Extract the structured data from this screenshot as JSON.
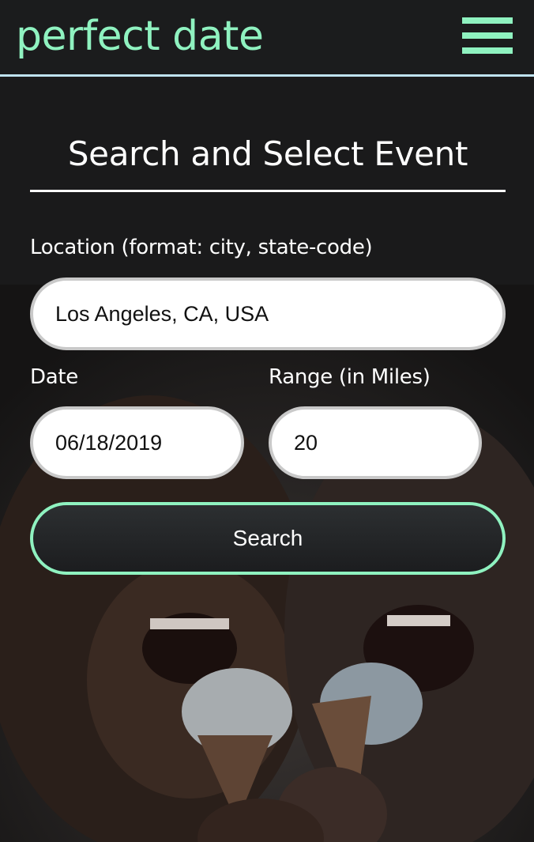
{
  "header": {
    "brand": "perfect date",
    "menu_icon": "hamburger-menu-icon"
  },
  "form": {
    "title": "Search and Select Event",
    "location_label": "Location (format: city, state-code)",
    "location_value": "Los Angeles, CA, USA",
    "date_label": "Date",
    "date_value": "06/18/2019",
    "range_label": "Range (in Miles)",
    "range_value": "20",
    "search_label": "Search"
  },
  "colors": {
    "accent": "#8ff2c0",
    "header_border": "#bfe3f0",
    "background": "#1b1b1c"
  }
}
